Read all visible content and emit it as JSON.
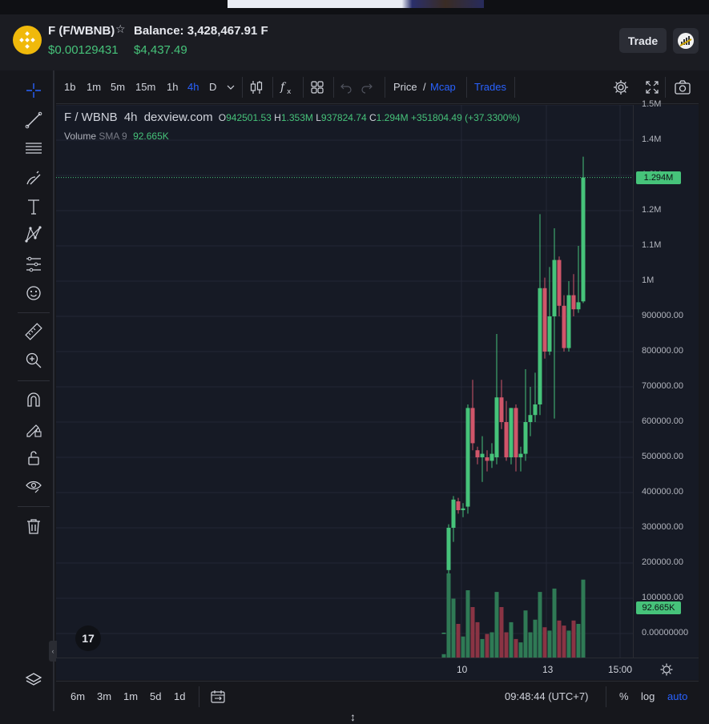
{
  "header": {
    "pair": "F (F/WBNB)",
    "balance": "Balance: 3,428,467.91 F",
    "price_native": "$0.00129431",
    "price_usd": "$4,437.49",
    "trade_label": "Trade",
    "icons": {
      "token": "bnb-token-icon",
      "favorite": "star-icon",
      "account": "account-avatar-icon"
    }
  },
  "toolbar": {
    "timeframes": [
      "1b",
      "1m",
      "5m",
      "15m",
      "1h",
      "4h",
      "D"
    ],
    "active_timeframe": "4h",
    "price_label": "Price",
    "separator": "/",
    "mcap_label": "Mcap",
    "trades_label": "Trades"
  },
  "legend": {
    "symbol": "F / WBNB",
    "interval": "4h",
    "source": "dexview.com",
    "o_label": "O",
    "open": "942501.53",
    "h_label": "H",
    "high": "1.353M",
    "l_label": "L",
    "low": "937824.74",
    "c_label": "C",
    "close": "1.294M",
    "change": "+351804.49 (+37.3300%)",
    "volume_label": "Volume",
    "sma_label": "SMA 9",
    "volume_value": "92.665K"
  },
  "chart_data": {
    "type": "candlestick",
    "y_axis_ticks": [
      "1.5M",
      "1.4M",
      "1.3M",
      "1.2M",
      "1.1M",
      "1M",
      "900000.00",
      "800000.00",
      "700000.00",
      "600000.00",
      "500000.00",
      "400000.00",
      "300000.00",
      "200000.00",
      "100000.00",
      "0.00000000"
    ],
    "x_axis_ticks": [
      "10",
      "13",
      "15:00"
    ],
    "ylim": [
      0,
      1500000
    ],
    "current_price_label": "1.294M",
    "volume_label": "92.665K",
    "colors": {
      "up": "#46c37a",
      "down": "#d0566a",
      "volume_up": "#2f7a55",
      "volume_down": "#8a3444"
    },
    "candles": [
      {
        "o": 1500,
        "h": 1700,
        "l": 1400,
        "c": 1600,
        "v": 4
      },
      {
        "o": 180000,
        "h": 310000,
        "l": 170000,
        "c": 300000,
        "v": 100
      },
      {
        "o": 300000,
        "h": 390000,
        "l": 260000,
        "c": 380000,
        "v": 70
      },
      {
        "o": 375000,
        "h": 385000,
        "l": 340000,
        "c": 350000,
        "v": 40
      },
      {
        "o": 350000,
        "h": 370000,
        "l": 330000,
        "c": 355000,
        "v": 25
      },
      {
        "o": 360000,
        "h": 650000,
        "l": 340000,
        "c": 640000,
        "v": 80
      },
      {
        "o": 640000,
        "h": 720000,
        "l": 520000,
        "c": 540000,
        "v": 60
      },
      {
        "o": 520000,
        "h": 530000,
        "l": 480000,
        "c": 500000,
        "v": 42
      },
      {
        "o": 500000,
        "h": 560000,
        "l": 430000,
        "c": 510000,
        "v": 22
      },
      {
        "o": 500000,
        "h": 520000,
        "l": 460000,
        "c": 490000,
        "v": 28
      },
      {
        "o": 490000,
        "h": 540000,
        "l": 470000,
        "c": 510000,
        "v": 30
      },
      {
        "o": 500000,
        "h": 850000,
        "l": 480000,
        "c": 670000,
        "v": 78
      },
      {
        "o": 670000,
        "h": 720000,
        "l": 580000,
        "c": 600000,
        "v": 60
      },
      {
        "o": 600000,
        "h": 660000,
        "l": 490000,
        "c": 500000,
        "v": 30
      },
      {
        "o": 500000,
        "h": 640000,
        "l": 480000,
        "c": 640000,
        "v": 42
      },
      {
        "o": 640000,
        "h": 650000,
        "l": 460000,
        "c": 500000,
        "v": 22
      },
      {
        "o": 500000,
        "h": 530000,
        "l": 460000,
        "c": 510000,
        "v": 18
      },
      {
        "o": 510000,
        "h": 750000,
        "l": 490000,
        "c": 600000,
        "v": 56
      },
      {
        "o": 600000,
        "h": 700000,
        "l": 560000,
        "c": 620000,
        "v": 30
      },
      {
        "o": 620000,
        "h": 740000,
        "l": 600000,
        "c": 650000,
        "v": 45
      },
      {
        "o": 650000,
        "h": 1190000,
        "l": 620000,
        "c": 980000,
        "v": 78
      },
      {
        "o": 980000,
        "h": 1010000,
        "l": 780000,
        "c": 800000,
        "v": 36
      },
      {
        "o": 800000,
        "h": 1040000,
        "l": 790000,
        "c": 900000,
        "v": 32
      },
      {
        "o": 900000,
        "h": 1150000,
        "l": 610000,
        "c": 1060000,
        "v": 82
      },
      {
        "o": 1060000,
        "h": 1070000,
        "l": 900000,
        "c": 930000,
        "v": 44
      },
      {
        "o": 930000,
        "h": 960000,
        "l": 800000,
        "c": 810000,
        "v": 38
      },
      {
        "o": 810000,
        "h": 1000000,
        "l": 800000,
        "c": 960000,
        "v": 32
      },
      {
        "o": 960000,
        "h": 1020000,
        "l": 900000,
        "c": 920000,
        "v": 44
      },
      {
        "o": 920000,
        "h": 1100000,
        "l": 910000,
        "c": 940000,
        "v": 40
      },
      {
        "o": 942501.53,
        "h": 1353000,
        "l": 937824.74,
        "c": 1294000,
        "v": 92.665
      }
    ]
  },
  "time_display": "09:48:44 (UTC+7)",
  "bottom": {
    "ranges": [
      "6m",
      "3m",
      "1m",
      "5d",
      "1d"
    ],
    "percent_label": "%",
    "log_label": "log",
    "auto_label": "auto"
  },
  "tradingview_logo": "17"
}
